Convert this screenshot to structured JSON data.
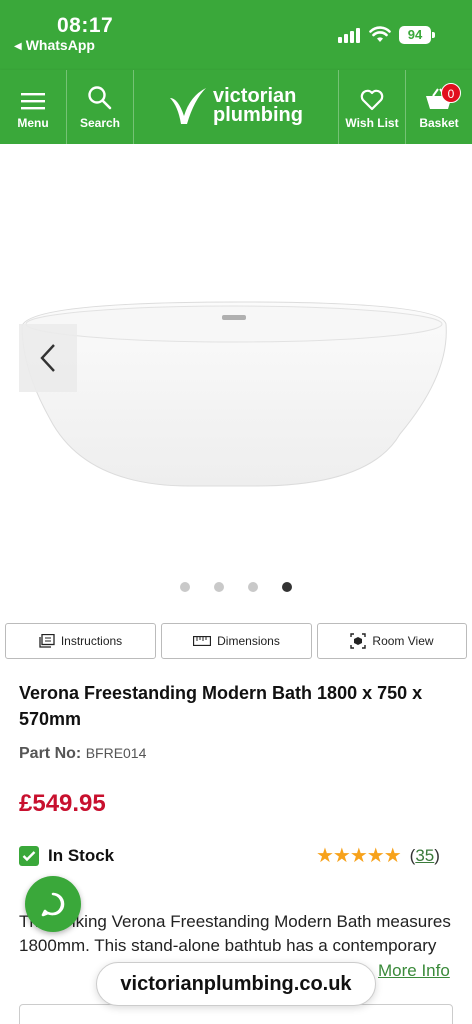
{
  "status_bar": {
    "time": "08:17",
    "back_app": "WhatsApp",
    "battery": "94"
  },
  "header": {
    "menu_label": "Menu",
    "search_label": "Search",
    "logo_line1": "victorian",
    "logo_line2": "plumbing",
    "wishlist_label": "Wish List",
    "basket_label": "Basket",
    "basket_count": "0",
    "brand_color": "#3aa83a"
  },
  "gallery": {
    "image_icon": "bath-product-image",
    "slide_count": 4,
    "active_slide": 4
  },
  "tabs": {
    "instructions": "Instructions",
    "dimensions": "Dimensions",
    "room_view": "Room View"
  },
  "product": {
    "title": "Verona Freestanding Modern Bath 1800 x 750 x 570mm",
    "part_label": "Part No:",
    "part_number": "BFRE014",
    "price": "£549.95",
    "price_color": "#c8102e",
    "stock": "In Stock",
    "stars": "★★★★★",
    "review_count": "35",
    "rating_open": "(",
    "rating_close": ")",
    "description": "The striking Verona Freestanding Modern Bath measures 1800mm. This stand-alone bathtub has a contemporary",
    "more_info": "More Info"
  },
  "browser": {
    "url": "victorianplumbing.co.uk"
  }
}
